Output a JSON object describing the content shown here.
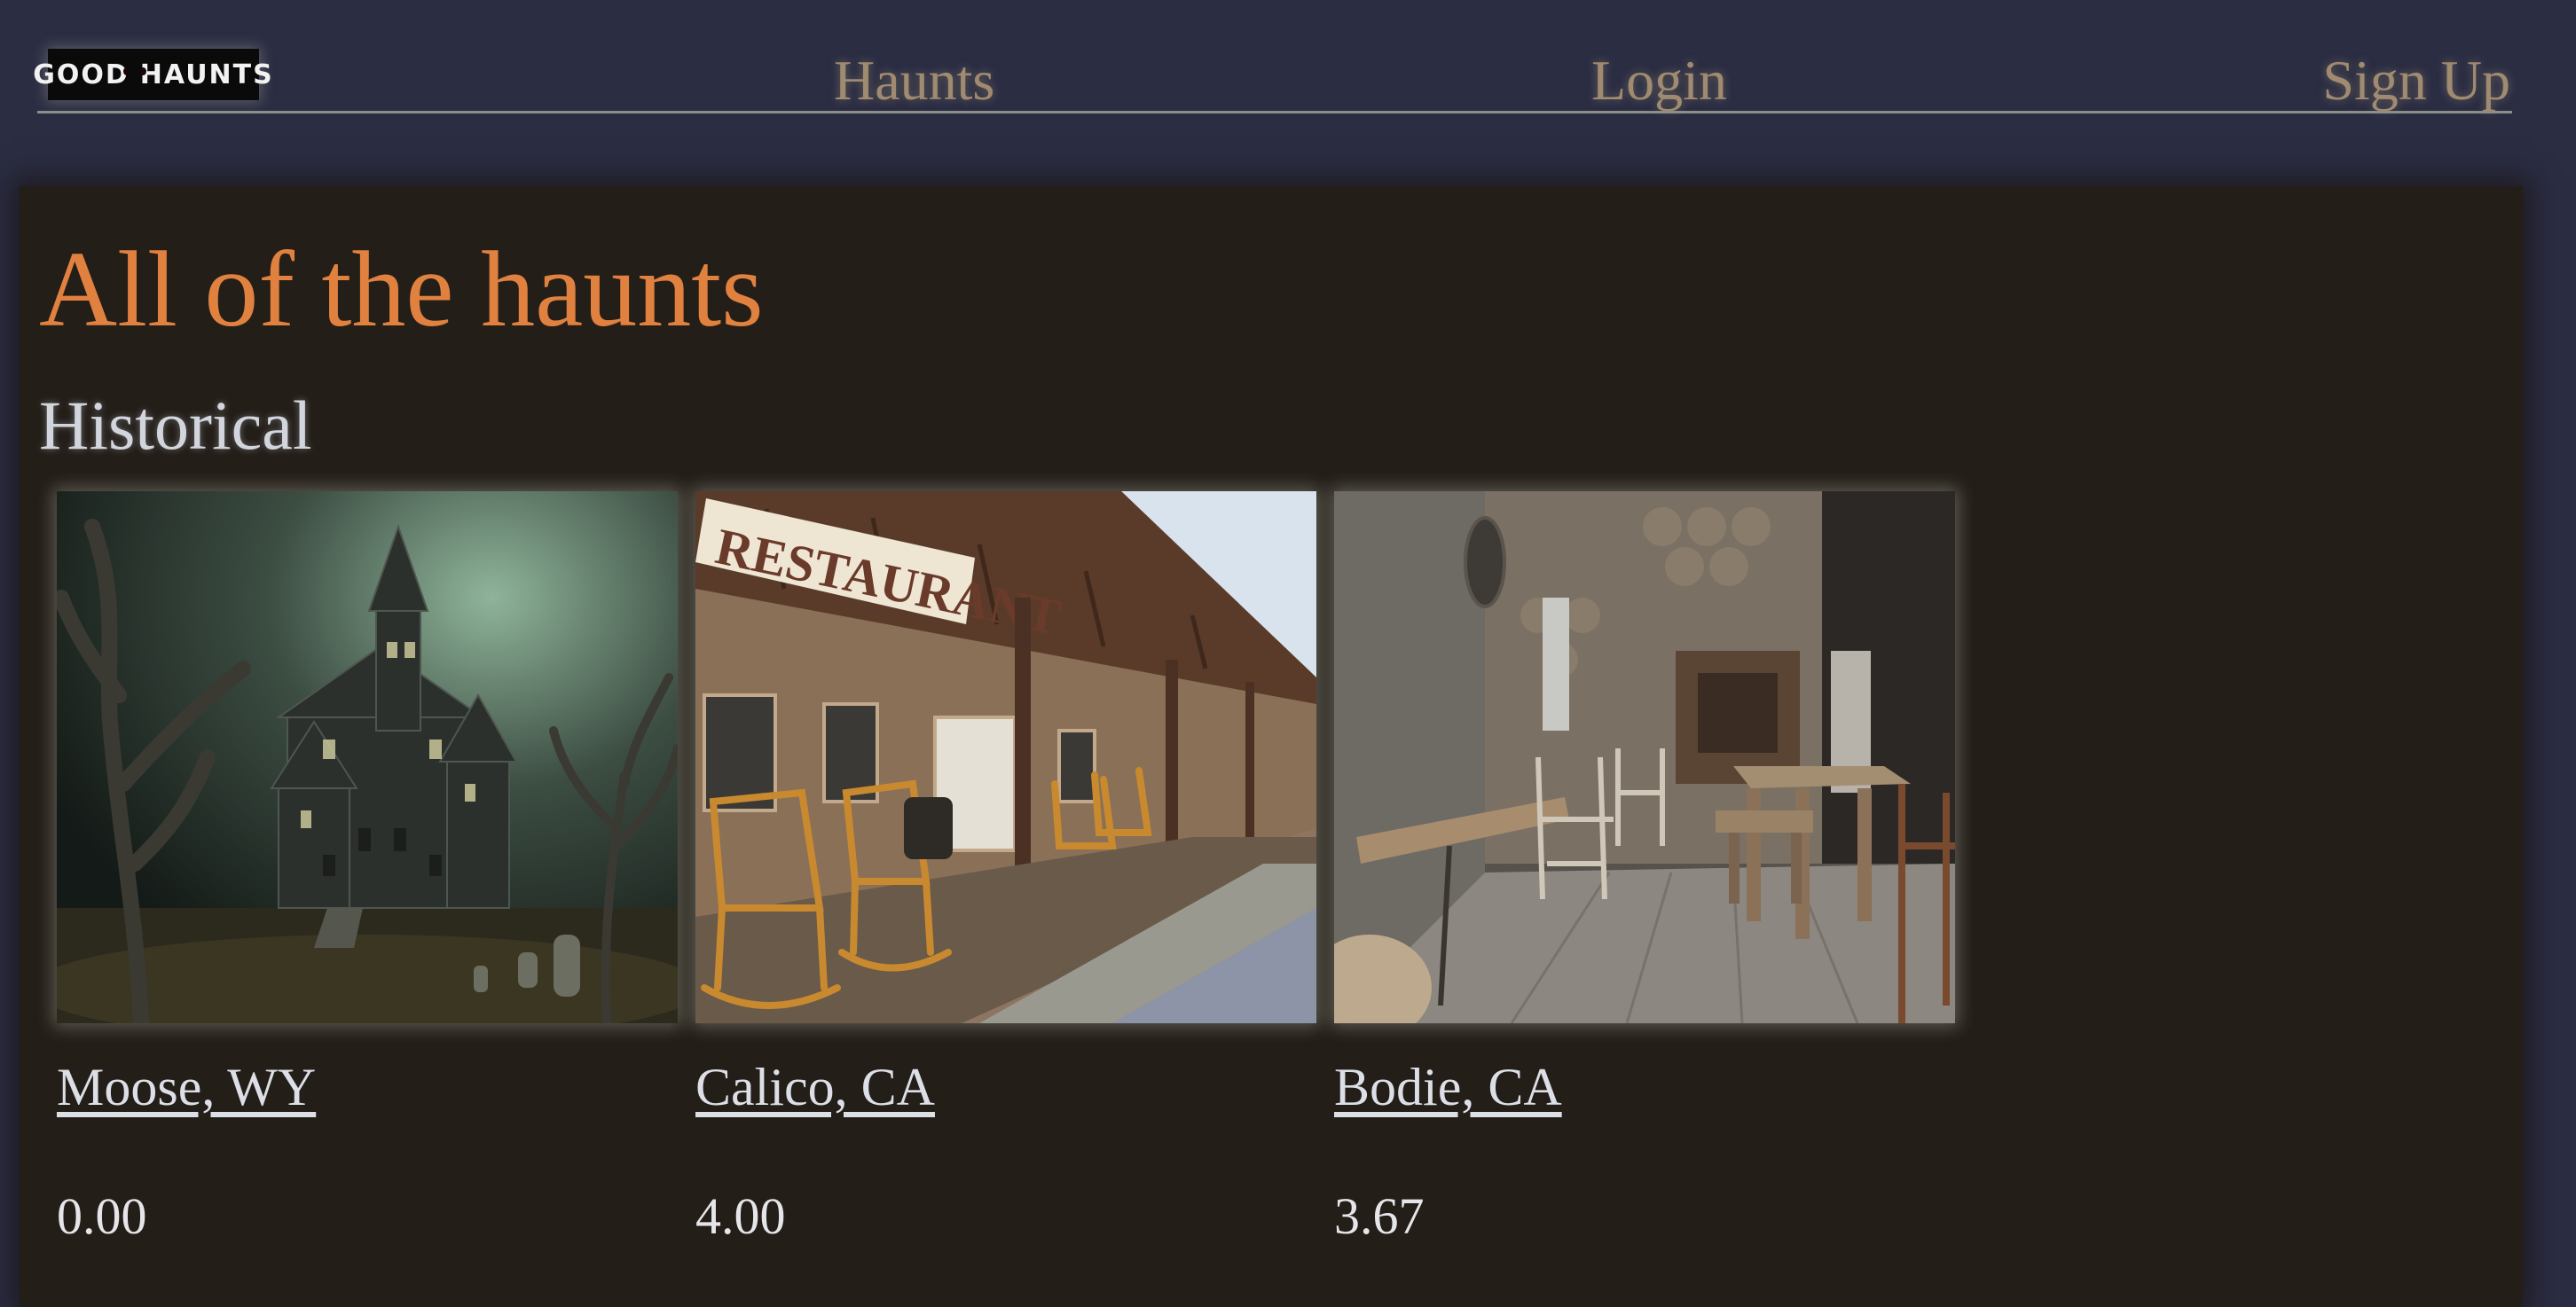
{
  "header": {
    "logo": {
      "left_text": "GOOD",
      "right_text": "HAUNTS",
      "icon": "ghost-icon"
    },
    "nav": [
      {
        "label": "Haunts"
      },
      {
        "label": "Login"
      },
      {
        "label": "Sign Up"
      }
    ]
  },
  "main": {
    "title": "All of the haunts",
    "section": "Historical",
    "haunts": [
      {
        "name": "Moose, WY",
        "rating": "0.00",
        "image": "haunted-mansion-image"
      },
      {
        "name": "Calico, CA",
        "rating": "4.00",
        "image": "restaurant-porch-image"
      },
      {
        "name": "Bodie, CA",
        "rating": "3.67",
        "image": "abandoned-interior-image"
      }
    ],
    "restaurant_sign": "RESTAURANT"
  },
  "colors": {
    "background": "#2b2d43",
    "panel": "#241e19",
    "title": "#e0813f",
    "nav_link": "#a08a70",
    "text": "#dcdfe6"
  }
}
